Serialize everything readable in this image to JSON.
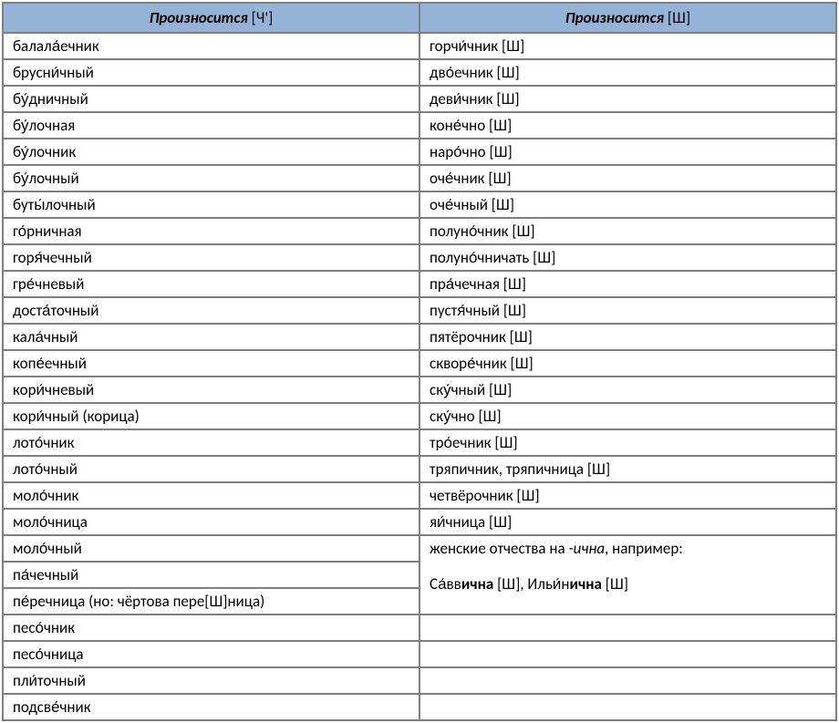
{
  "headers": {
    "col1_main": "Произносится",
    "col1_bracket": " [Ч']",
    "col2_main": "Произносится",
    "col2_bracket": " [Ш]"
  },
  "col1": [
    "балала́ечник",
    "брусни́чный",
    "бу́дничный",
    "бу́лочная",
    "бу́лочник",
    "бу́лочный",
    "буты́лочный",
    "го́рничная",
    "горя́чечный",
    "гре́чневый",
    "доста́точный",
    "кала́чный",
    "копе́ечный",
    "кори́чневый",
    "кори́чный (корица)",
    "лото́чник",
    "лото́чный",
    "моло́чник",
    "моло́чница",
    "моло́чный",
    "па́чечный",
    "пе́речница (но: чёртова пере[Ш]ница)",
    "песо́чник",
    "песо́чница",
    "пли́точный",
    "подсве́чник"
  ],
  "col2": [
    "горчи́чник [Ш]",
    "дво́ечник [Ш]",
    "деви́чник [Ш]",
    "коне́чно [Ш]",
    "наро́чно [Ш]",
    "оче́чник [Ш]",
    "оче́чный [Ш]",
    "полуно́чник [Ш]",
    "полуно́чничать [Ш]",
    "пра́чечная [Ш]",
    "пустя́чный [Ш]",
    "пятёрочник [Ш]",
    "скворе́чник [Ш]",
    "ску́чный [Ш]",
    "ску́чно [Ш]",
    "тро́ечник [Ш]",
    "тряпичник, тряпичница [Ш]",
    "четвёрочник [Ш]",
    "яи́чница [Ш]"
  ],
  "merged": {
    "line1_a": "женские отчества ",
    "line1_b": "на ",
    "line1_c": "-ична",
    "line1_d": ", например:",
    "line2_a": " Са́вв",
    "line2_b": "ична",
    "line2_c": " [Ш], Ильи́н",
    "line2_d": "ична",
    "line2_e": " [Ш]"
  }
}
